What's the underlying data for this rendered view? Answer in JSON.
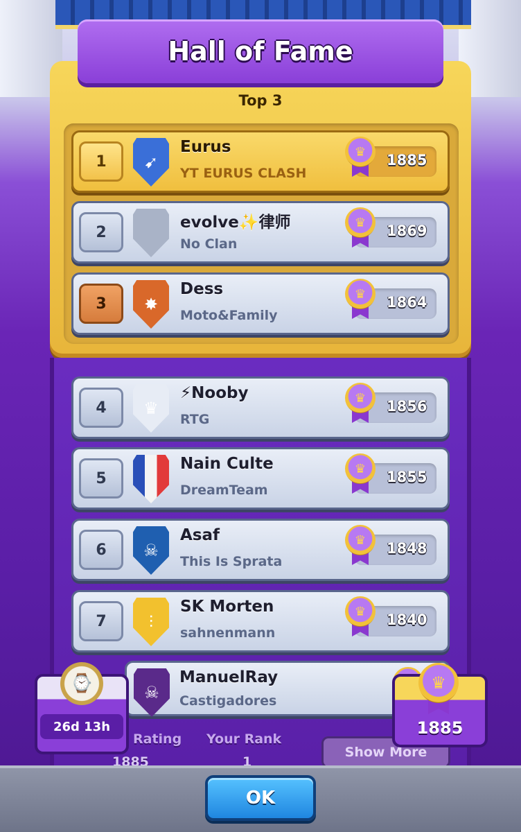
{
  "header": {
    "title": "Hall of Fame",
    "subtitle": "Top 3"
  },
  "players": [
    {
      "rank": "1",
      "name": "Eurus",
      "clan": "YT EURUS CLASH",
      "trophies": "1885",
      "badge_icon": "arrow-shield-icon",
      "badge_color": "#3a6fd8"
    },
    {
      "rank": "2",
      "name": "evolve✨律师",
      "clan": "No Clan",
      "trophies": "1869",
      "badge_icon": "empty-shield-icon",
      "badge_color": "#a9b3c7"
    },
    {
      "rank": "3",
      "name": "Dess",
      "clan": "Moto&Family",
      "trophies": "1864",
      "badge_icon": "star-shield-icon",
      "badge_color": "#d9682a"
    },
    {
      "rank": "4",
      "name": "⚡Nooby",
      "clan": "RTG",
      "trophies": "1856",
      "badge_icon": "crown-shield-icon",
      "badge_color": "#e7ecf5"
    },
    {
      "rank": "5",
      "name": "Nain Culte",
      "clan": "DreamTeam",
      "trophies": "1855",
      "badge_icon": "france-flag-shield-icon",
      "badge_color": "#e9edf5"
    },
    {
      "rank": "6",
      "name": "Asaf",
      "clan": "This Is Sprata",
      "trophies": "1848",
      "badge_icon": "skull-shield-icon",
      "badge_color": "#1f5fb0"
    },
    {
      "rank": "7",
      "name": "SK Morten",
      "clan": "sahnenmann",
      "trophies": "1840",
      "badge_icon": "bamboo-shield-icon",
      "badge_color": "#f2c12e"
    },
    {
      "rank": "",
      "name": "ManuelRay",
      "clan": "Castigadores",
      "trophies": "",
      "badge_icon": "purple-skull-shield-icon",
      "badge_color": "#5a2a8a"
    }
  ],
  "timer": {
    "value": "26d 13h",
    "icon": "clock-icon"
  },
  "my_stats": {
    "rating_label": "Rating",
    "rating_value": "1885",
    "rank_label": "Your Rank",
    "rank_value": "1",
    "show_more_label": "Show More",
    "trophies": "1885"
  },
  "footer": {
    "ok_label": "OK"
  },
  "colors": {
    "gold": "#f2c24a",
    "purple": "#6a2cc0",
    "ok_blue": "#1f86e0"
  }
}
